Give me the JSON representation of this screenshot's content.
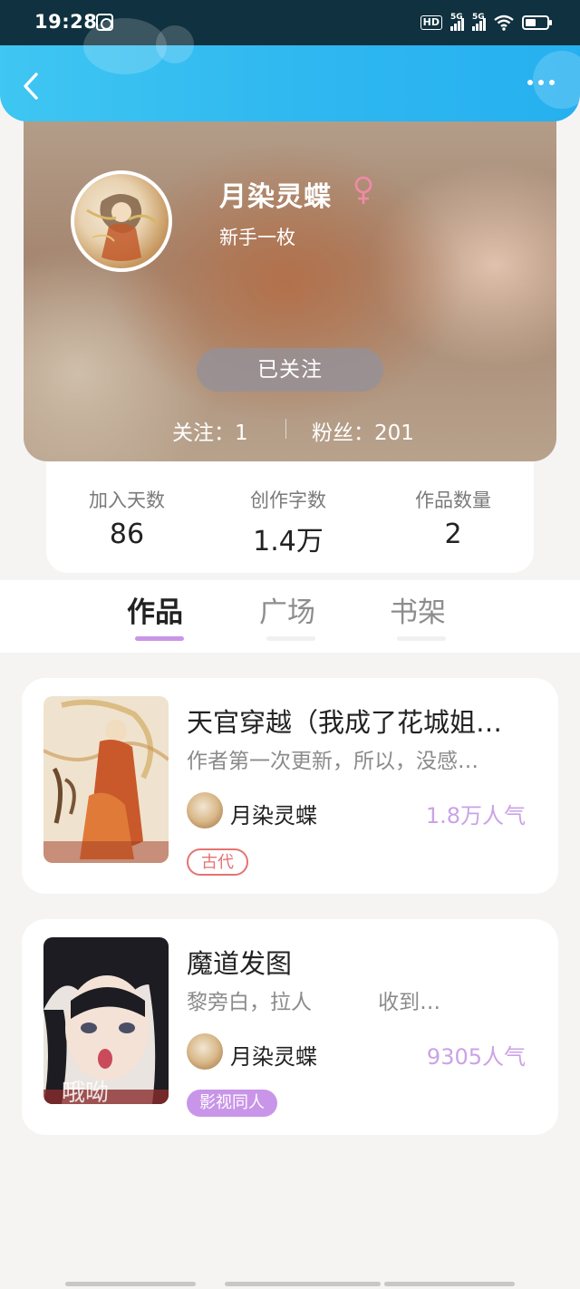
{
  "status_bar": {
    "time": "19:28",
    "signal_1": "5G",
    "signal_2": "5G",
    "hd": "HD"
  },
  "header": {
    "back_icon": "chevron-left-icon",
    "more_icon": "more-dots-icon"
  },
  "profile": {
    "name": "月染灵蝶",
    "gender_icon": "female-symbol-icon",
    "gender_color": "#f18aa8",
    "bio": "新手一枚",
    "follow_button": "已关注",
    "following_label": "关注：1",
    "fans_label": "粉丝：201"
  },
  "stats": [
    {
      "label": "加入天数",
      "value": "86"
    },
    {
      "label": "创作字数",
      "value": "1.4万"
    },
    {
      "label": "作品数量",
      "value": "2"
    }
  ],
  "tabs": [
    {
      "label": "作品",
      "active": true
    },
    {
      "label": "广场",
      "active": false
    },
    {
      "label": "书架",
      "active": false
    }
  ],
  "works": [
    {
      "title": "天官穿越（我成了花城姐…",
      "description": "作者第一次更新，所以，没感…",
      "author": "月染灵蝶",
      "popularity": "1.8万人气",
      "tag": "古代",
      "tag_style": "outline"
    },
    {
      "title": "魔道发图",
      "description": "黎旁白，拉人          收到…",
      "author": "月染灵蝶",
      "popularity": "9305人气",
      "tag": "影视同人",
      "tag_style": "filled",
      "cover_text": "哦呦"
    }
  ],
  "colors": {
    "header_blue": "#2eb7f0",
    "accent_purple": "#c995e8",
    "tag_red": "#e57373"
  }
}
